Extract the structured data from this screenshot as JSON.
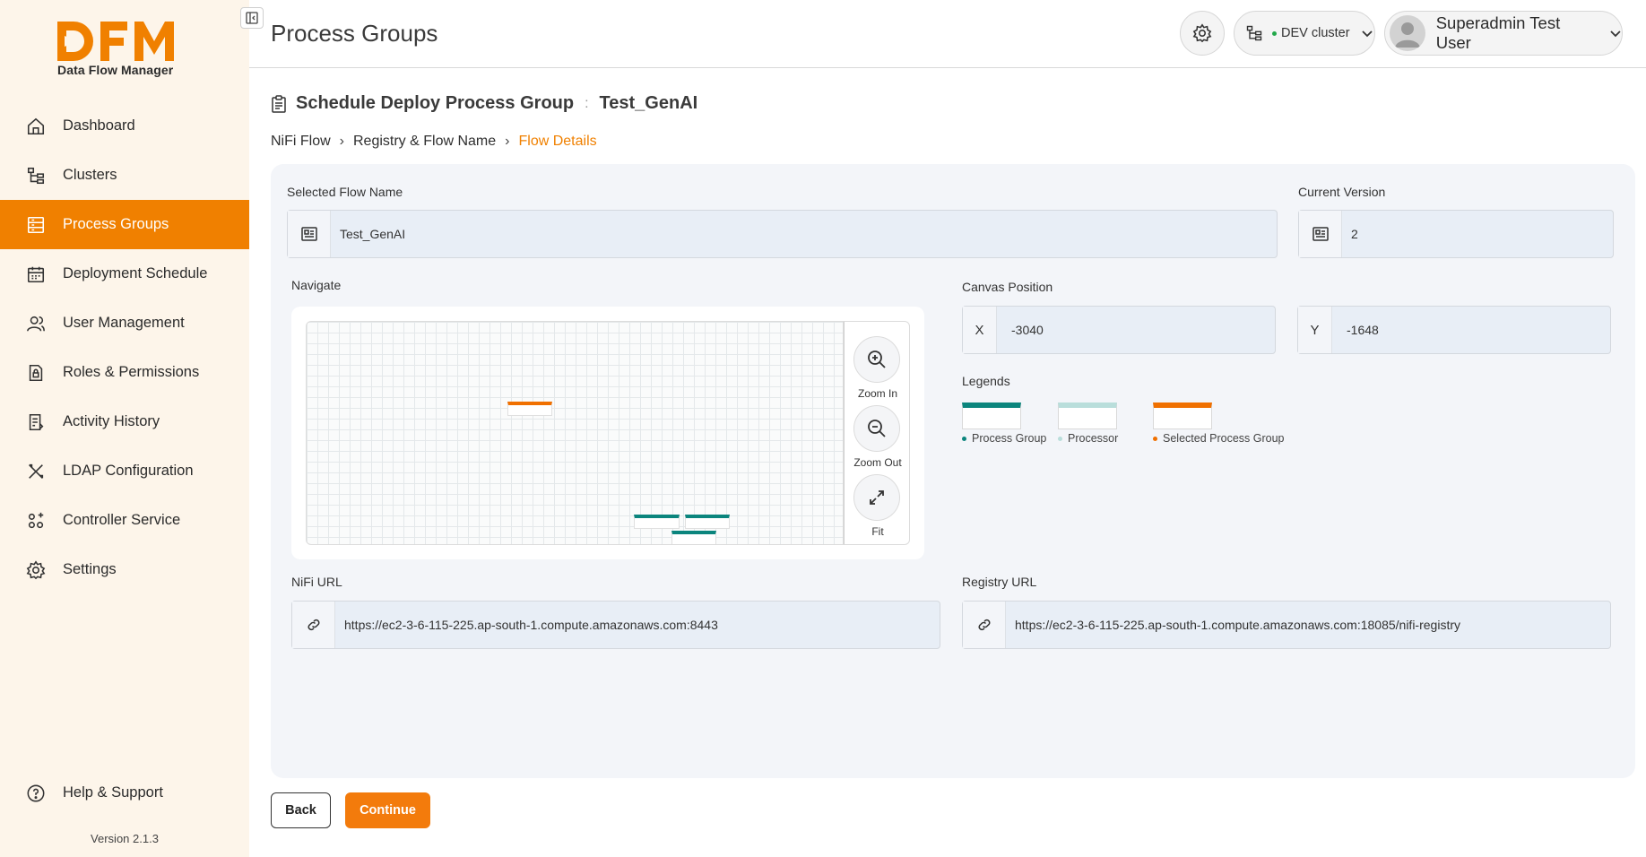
{
  "app": {
    "logo_text": "DFM",
    "logo_subtitle": "Data Flow Manager",
    "version": "Version 2.1.3",
    "brand_color": "#f08000"
  },
  "sidebar": {
    "items": [
      {
        "label": "Dashboard",
        "icon": "home-icon"
      },
      {
        "label": "Clusters",
        "icon": "cluster-tree-icon"
      },
      {
        "label": "Process Groups",
        "icon": "process-groups-icon",
        "active": true
      },
      {
        "label": "Deployment Schedule",
        "icon": "calendar-icon"
      },
      {
        "label": "User Management",
        "icon": "users-icon"
      },
      {
        "label": "Roles & Permissions",
        "icon": "lock-document-icon"
      },
      {
        "label": "Activity History",
        "icon": "history-document-icon"
      },
      {
        "label": "LDAP Configuration",
        "icon": "tools-icon"
      },
      {
        "label": "Controller Service",
        "icon": "controller-icon"
      },
      {
        "label": "Settings",
        "icon": "gear-icon"
      }
    ],
    "help_label": "Help & Support"
  },
  "header": {
    "title": "Process Groups",
    "cluster_label": "DEV cluster",
    "cluster_status_color": "#22a84a",
    "user_name": "Superadmin Test User"
  },
  "section": {
    "title": "Schedule Deploy Process Group",
    "separator": ":",
    "flow_name": "Test_GenAI"
  },
  "breadcrumb": {
    "items": [
      "NiFi Flow",
      "Registry & Flow Name",
      "Flow Details"
    ]
  },
  "form": {
    "selected_flow_name_label": "Selected Flow Name",
    "selected_flow_name_value": "Test_GenAI",
    "current_version_label": "Current Version",
    "current_version_value": "2",
    "navigate_label": "Navigate",
    "canvas_position_label": "Canvas Position",
    "x_label": "X",
    "x_value": "-3040",
    "y_label": "Y",
    "y_value": "-1648",
    "legends_label": "Legends",
    "nifi_url_label": "NiFi URL",
    "nifi_url_value": "https://ec2-3-6-115-225.ap-south-1.compute.amazonaws.com:8443",
    "registry_url_label": "Registry URL",
    "registry_url_value": "https://ec2-3-6-115-225.ap-south-1.compute.amazonaws.com:18085/nifi-registry"
  },
  "navigator": {
    "zoom_in_label": "Zoom In",
    "zoom_out_label": "Zoom Out",
    "fit_label": "Fit"
  },
  "legends": [
    {
      "label": "Process Group",
      "color": "#0b857d"
    },
    {
      "label": "Processor",
      "color": "#b9dedb"
    },
    {
      "label": "Selected Process Group",
      "color": "#f07000"
    }
  ],
  "actions": {
    "back_label": "Back",
    "continue_label": "Continue"
  }
}
